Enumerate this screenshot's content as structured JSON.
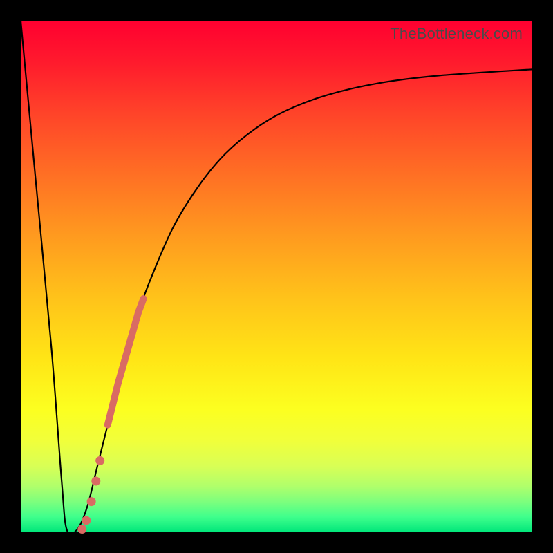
{
  "watermark": "TheBottleneck.com",
  "colors": {
    "highlight": "#d96b63",
    "curve": "#000000",
    "frame": "#000000"
  },
  "chart_data": {
    "type": "line",
    "title": "",
    "xlabel": "",
    "ylabel": "",
    "xlim": [
      0,
      100
    ],
    "ylim": [
      0,
      100
    ],
    "grid": false,
    "legend": false,
    "description": "Bottleneck-style curve: steep drop from top-left to a minimum near x≈9, short flat floor, then asymptotic rise toward ~90 at the right edge. Background is a vertical red→green gradient (green = low bottleneck).",
    "series": [
      {
        "name": "bottleneck-curve",
        "x": [
          0,
          3,
          6,
          8,
          9,
          11,
          13,
          15,
          17,
          19,
          21,
          23,
          26,
          30,
          35,
          40,
          46,
          52,
          60,
          70,
          82,
          100
        ],
        "y": [
          100,
          68,
          36,
          10,
          0.5,
          0.5,
          5,
          13,
          21,
          29,
          36,
          43,
          51,
          60,
          68,
          74,
          79,
          82.5,
          85.5,
          87.8,
          89.3,
          90.5
        ]
      }
    ],
    "highlight_segment": {
      "x_start": 17,
      "x_end": 24,
      "note": "thick salmon overlay on rising limb"
    },
    "dots": [
      {
        "x": 15.5,
        "y": 14
      },
      {
        "x": 14.7,
        "y": 10
      },
      {
        "x": 13.8,
        "y": 6
      },
      {
        "x": 12.8,
        "y": 2.3
      },
      {
        "x": 12.0,
        "y": 0.6
      }
    ]
  }
}
